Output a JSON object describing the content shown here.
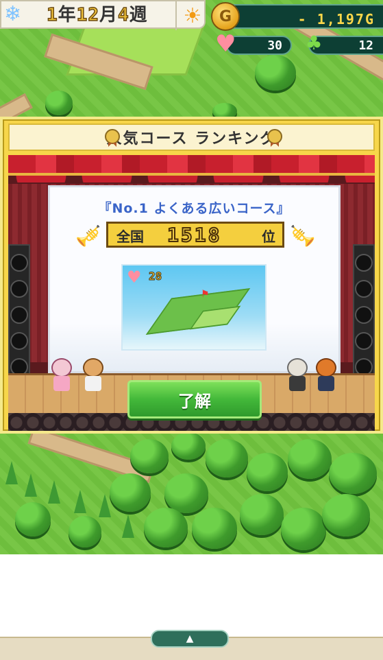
{
  "hud": {
    "date": {
      "year": "1",
      "year_unit": "年",
      "month": "12",
      "month_unit": "月",
      "week": "4",
      "week_unit": "週"
    },
    "weather_icon": "sun-icon",
    "season_icon": "snowflake-icon",
    "money": "- 1,197G",
    "popularity": "30",
    "trees": "12"
  },
  "dialog": {
    "title": "人気コース ランキング",
    "course_name": "『No.1 よくある広いコース』",
    "rank_label": "全国",
    "rank_value": "1518",
    "rank_suffix": "位",
    "course_popularity": "28",
    "ok_label": "了解"
  },
  "bottom": {
    "expand_glyph": "▲"
  },
  "colors": {
    "dialog_frame": "#f7d64a",
    "ok_button": "#43b83a",
    "money_text": "#ffd84a",
    "course_name_text": "#3a64c8"
  }
}
